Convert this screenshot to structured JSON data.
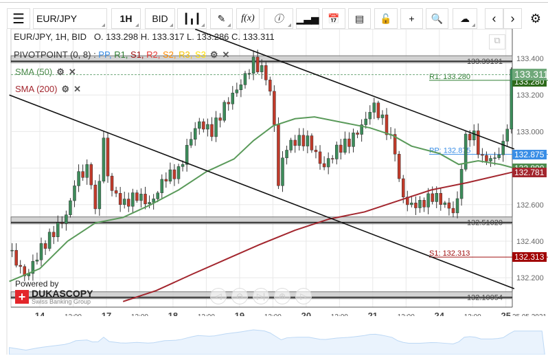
{
  "toolbar": {
    "symbol": "EUR/JPY",
    "timeframe": "1H",
    "side": "BID",
    "icons": [
      "menu-icon",
      "candlestick-icon",
      "pencil-icon",
      "function-icon",
      "info-icon",
      "bar-chart-icon",
      "calendar-icon",
      "news-icon",
      "lock-icon",
      "crosshair-icon",
      "zoom-search-icon",
      "cloud-upload-icon",
      "chevron-left-icon",
      "chevron-right-icon",
      "gear-icon"
    ],
    "fx_label": "f(x)"
  },
  "header": {
    "title": "EUR/JPY, 1H, BID",
    "ohlc": "O. 133.298 H. 133.317 L. 133.286 C. 133.311"
  },
  "indicators": {
    "pivot_label": "PIVOTPOINT (0, 8)",
    "pivot_sep": " : ",
    "pivot_levels": [
      {
        "t": "PP",
        "c": "#3a8ee6"
      },
      {
        "t": "R1",
        "c": "#2e7d32"
      },
      {
        "t": "S1",
        "c": "#a01010"
      },
      {
        "t": "R2",
        "c": "#e53935"
      },
      {
        "t": "S2",
        "c": "#ff8c00"
      },
      {
        "t": "R3",
        "c": "#f5c400"
      },
      {
        "t": "S3",
        "c": "#ffe000"
      }
    ],
    "sma50": "SMA (50)",
    "sma200": "SMA (200)"
  },
  "branding": {
    "powered": "Powered by",
    "name": "DUKASCOPY",
    "sub": "Swiss Banking Group"
  },
  "chart_data": {
    "type": "candlestick",
    "x_unit": "hours from 14 May 00:00 (trading time)",
    "xlim": [
      -11,
      171
    ],
    "ylim": [
      132.07,
      133.56
    ],
    "y_ticks": [
      "133.400",
      "133.200",
      "133.000",
      "132.800",
      "132.600",
      "132.400",
      "132.200"
    ],
    "x_ticks": [
      {
        "h": 0,
        "t": "14",
        "major": true
      },
      {
        "h": 12,
        "t": "12:00"
      },
      {
        "h": 24,
        "t": "17",
        "major": true
      },
      {
        "h": 36,
        "t": "12:00"
      },
      {
        "h": 48,
        "t": "18",
        "major": true
      },
      {
        "h": 60,
        "t": "12:00"
      },
      {
        "h": 72,
        "t": "19",
        "major": true
      },
      {
        "h": 84,
        "t": "12:00"
      },
      {
        "h": 96,
        "t": "20",
        "major": true
      },
      {
        "h": 108,
        "t": "12:00"
      },
      {
        "h": 120,
        "t": "21",
        "major": true
      },
      {
        "h": 132,
        "t": "12:00"
      },
      {
        "h": 144,
        "t": "24",
        "major": true
      },
      {
        "h": 156,
        "t": "12:00"
      },
      {
        "h": 168,
        "t": "25",
        "major": true
      }
    ],
    "date_label": "25.05.2021",
    "price_path": [
      [
        -11,
        132.35
      ],
      [
        -5,
        132.2
      ],
      [
        0,
        132.35
      ],
      [
        5,
        132.45
      ],
      [
        10,
        132.55
      ],
      [
        13,
        132.75
      ],
      [
        18,
        132.8
      ],
      [
        20,
        132.55
      ],
      [
        23,
        132.95
      ],
      [
        25,
        132.7
      ],
      [
        30,
        132.6
      ],
      [
        35,
        132.65
      ],
      [
        40,
        132.6
      ],
      [
        45,
        132.75
      ],
      [
        50,
        132.78
      ],
      [
        54,
        132.95
      ],
      [
        57,
        133.05
      ],
      [
        62,
        133.0
      ],
      [
        67,
        133.15
      ],
      [
        72,
        133.25
      ],
      [
        77,
        133.38
      ],
      [
        82,
        133.3
      ],
      [
        85,
        133.0
      ],
      [
        86,
        132.7
      ],
      [
        88,
        132.9
      ],
      [
        92,
        132.95
      ],
      [
        97,
        132.95
      ],
      [
        102,
        132.8
      ],
      [
        107,
        132.9
      ],
      [
        112,
        132.95
      ],
      [
        117,
        133.05
      ],
      [
        120,
        133.15
      ],
      [
        124,
        133.05
      ],
      [
        128,
        132.9
      ],
      [
        129,
        132.75
      ],
      [
        132,
        132.6
      ],
      [
        137,
        132.6
      ],
      [
        142,
        132.65
      ],
      [
        146,
        132.6
      ],
      [
        150,
        132.55
      ],
      [
        153,
        132.95
      ],
      [
        156,
        133.0
      ],
      [
        159,
        132.85
      ],
      [
        164,
        132.85
      ],
      [
        168,
        132.95
      ],
      [
        170,
        133.311
      ]
    ],
    "sma50": [
      [
        -11,
        132.18
      ],
      [
        0,
        132.25
      ],
      [
        10,
        132.4
      ],
      [
        20,
        132.5
      ],
      [
        30,
        132.53
      ],
      [
        40,
        132.6
      ],
      [
        50,
        132.68
      ],
      [
        60,
        132.78
      ],
      [
        70,
        132.85
      ],
      [
        77,
        132.95
      ],
      [
        84,
        133.03
      ],
      [
        92,
        133.07
      ],
      [
        99,
        133.08
      ],
      [
        109,
        133.05
      ],
      [
        119,
        133.02
      ],
      [
        127,
        132.98
      ],
      [
        134,
        132.92
      ],
      [
        144,
        132.88
      ],
      [
        151,
        132.82
      ],
      [
        158,
        132.84
      ],
      [
        166,
        132.82
      ],
      [
        171,
        132.8
      ]
    ],
    "sma200": [
      [
        30,
        132.07
      ],
      [
        42,
        132.13
      ],
      [
        55,
        132.22
      ],
      [
        67,
        132.3
      ],
      [
        79,
        132.38
      ],
      [
        92,
        132.46
      ],
      [
        104,
        132.52
      ],
      [
        117,
        132.56
      ],
      [
        129,
        132.62
      ],
      [
        141,
        132.68
      ],
      [
        154,
        132.72
      ],
      [
        171,
        132.78
      ]
    ],
    "trendlines": [
      [
        [
          56,
          133.56
        ],
        [
          171,
          132.904
        ]
      ],
      [
        [
          -11,
          133.2
        ],
        [
          171,
          132.14
        ]
      ]
    ],
    "bands": [
      {
        "price": 133.39191,
        "label": "133.39191"
      },
      {
        "price": 132.5102,
        "label": "132.51020"
      },
      {
        "price": 132.10054,
        "label": "132.10054"
      }
    ],
    "pivots": [
      {
        "name": "R1",
        "price": 133.28,
        "label": "R1: 133.280",
        "color": "#2e7d32"
      },
      {
        "name": "PP",
        "price": 132.875,
        "label": "PP: 132.875",
        "color": "#3a8ee6"
      },
      {
        "name": "S1",
        "price": 132.313,
        "label": "S1: 132.313",
        "color": "#a01010"
      }
    ],
    "price_labels": [
      {
        "t": "133.311",
        "p": 133.311,
        "c": "#6fa87a"
      },
      {
        "t": "133.280",
        "p": 133.272,
        "c": "#2e6b1a"
      },
      {
        "t": "132.875",
        "p": 132.875,
        "c": "#3a8ee6"
      },
      {
        "t": "132.800",
        "p": 132.8,
        "c": "#4c8a4c"
      },
      {
        "t": "132.781",
        "p": 132.777,
        "c": "#a3262e"
      },
      {
        "t": "132.313",
        "p": 132.313,
        "c": "#a00000"
      }
    ]
  }
}
